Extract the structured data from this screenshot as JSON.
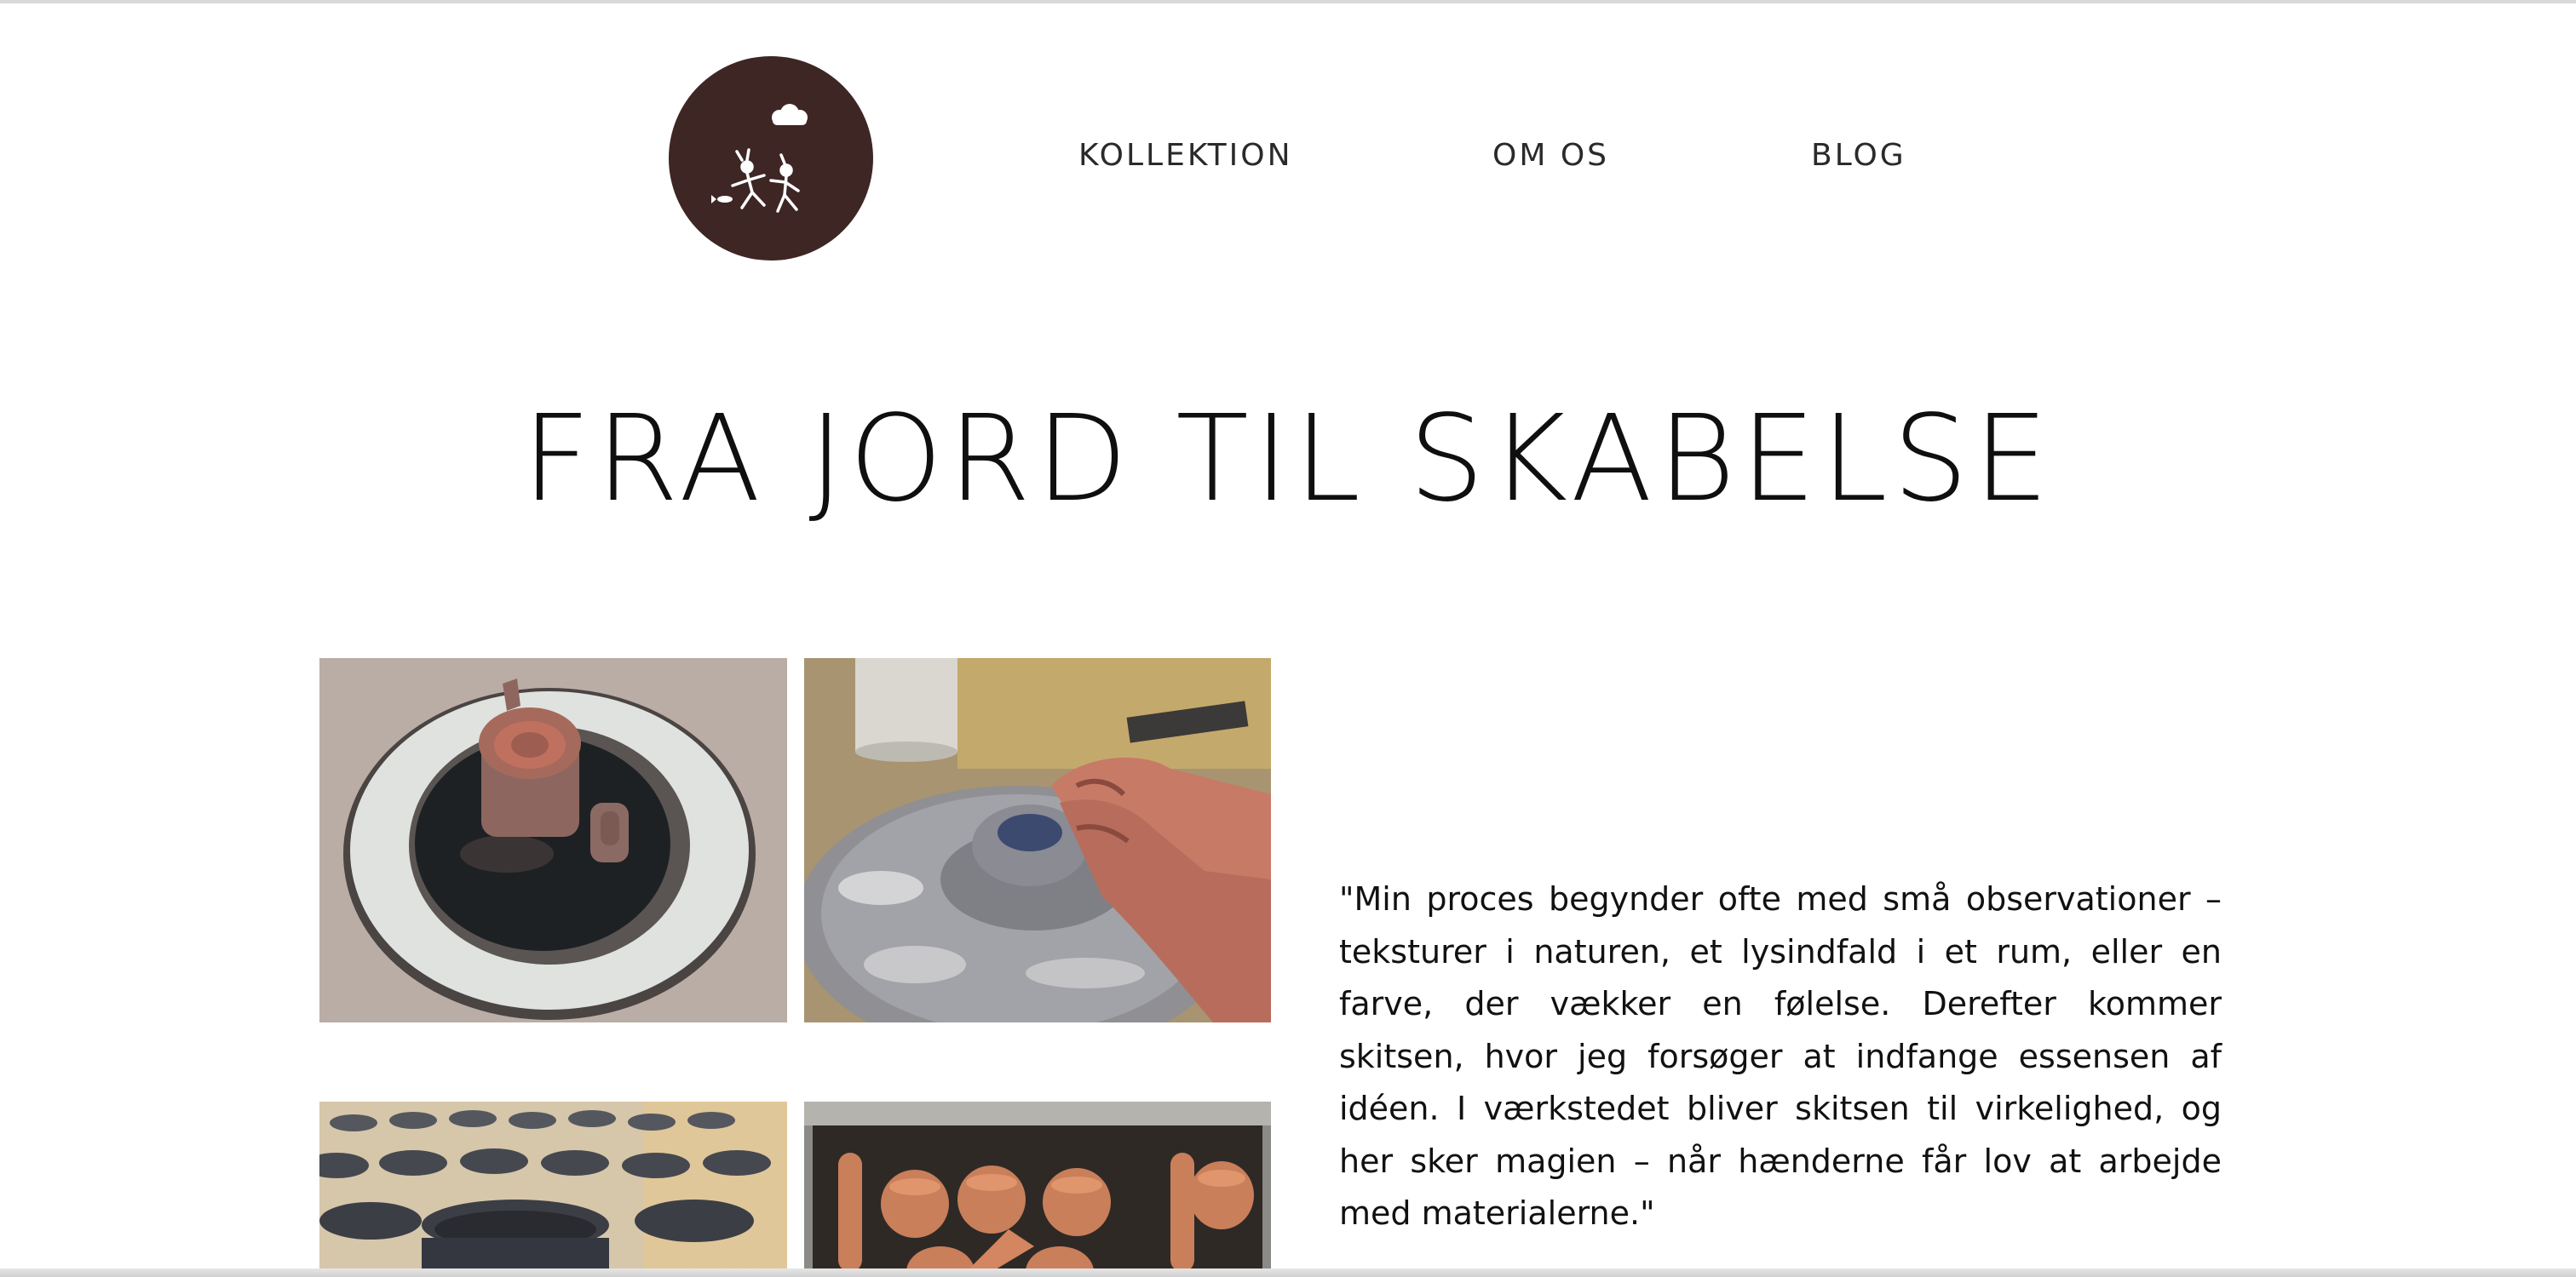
{
  "nav": {
    "items": [
      {
        "label": "KOLLEKTION"
      },
      {
        "label": "OM OS"
      },
      {
        "label": "BLOG"
      }
    ]
  },
  "hero": {
    "title": "FRA JORD TIL SKABELSE"
  },
  "quote": {
    "text": "\"Min proces begynder ofte med små observationer – teksturer i naturen, et lysindfald i et rum, eller en farve, der vækker en følelse. Derefter kommer skitsen, hvor jeg forsøger at indfange essensen af idéen. I værkstedet bliver skitsen til virkelighed, og her sker magien – når hænderne får lov at arbejde med materialerne.\""
  },
  "colors": {
    "logo_background": "#3e2625",
    "text": "#111111",
    "background": "#ffffff"
  },
  "gallery": [
    {
      "icon": "ceramic-teapot-photo"
    },
    {
      "icon": "pottery-wheel-hands-photo"
    },
    {
      "icon": "bowls-rows-photo"
    },
    {
      "icon": "terracotta-pots-tray-photo"
    }
  ]
}
